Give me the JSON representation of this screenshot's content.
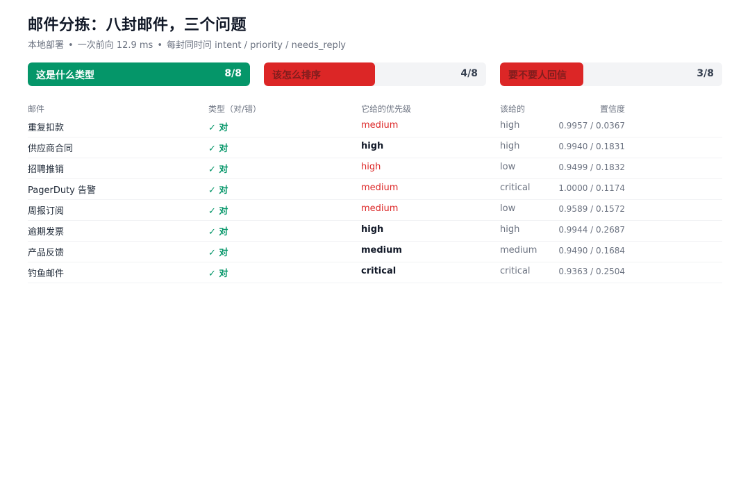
{
  "header": {
    "title": "邮件分拣：八封邮件，三个问题",
    "sub_deploy": "本地部署",
    "sub_latency": "一次前向 12.9 ms",
    "sub_fields": "每封同时问 intent / priority / needs_reply",
    "separator": "•"
  },
  "stats": [
    {
      "label": "这是什么类型",
      "score": "8/8",
      "correct": 8,
      "total": 8,
      "color": "#059669",
      "label_color": "#ffffff"
    },
    {
      "label": "该怎么排序",
      "score": "4/8",
      "correct": 4,
      "total": 8,
      "color": "#dc2626",
      "label_color": "#7f1d1d"
    },
    {
      "label": "要不要人回信",
      "score": "3/8",
      "correct": 3,
      "total": 8,
      "color": "#dc2626",
      "label_color": "#7f1d1d"
    }
  ],
  "table": {
    "headers": {
      "mail": "邮件",
      "type": "类型（对/错）",
      "given": "它给的优先级",
      "should": "该给的",
      "conf": "置信度"
    },
    "rows": [
      {
        "mail": "重复扣款",
        "type": "✓ 对",
        "given": "medium",
        "given_ok": false,
        "should": "high",
        "conf": "0.9957 / 0.0367"
      },
      {
        "mail": "供应商合同",
        "type": "✓ 对",
        "given": "high",
        "given_ok": true,
        "should": "high",
        "conf": "0.9940 / 0.1831"
      },
      {
        "mail": "招聘推销",
        "type": "✓ 对",
        "given": "high",
        "given_ok": false,
        "should": "low",
        "conf": "0.9499 / 0.1832"
      },
      {
        "mail": "PagerDuty 告警",
        "type": "✓ 对",
        "given": "medium",
        "given_ok": false,
        "should": "critical",
        "conf": "1.0000 / 0.1174"
      },
      {
        "mail": "周报订阅",
        "type": "✓ 对",
        "given": "medium",
        "given_ok": false,
        "should": "low",
        "conf": "0.9589 / 0.1572"
      },
      {
        "mail": "逾期发票",
        "type": "✓ 对",
        "given": "high",
        "given_ok": true,
        "should": "high",
        "conf": "0.9944 / 0.2687"
      },
      {
        "mail": "产品反馈",
        "type": "✓ 对",
        "given": "medium",
        "given_ok": true,
        "should": "medium",
        "conf": "0.9490 / 0.1684"
      },
      {
        "mail": "钓鱼邮件",
        "type": "✓ 对",
        "given": "critical",
        "given_ok": true,
        "should": "critical",
        "conf": "0.9363 / 0.2504"
      }
    ]
  }
}
